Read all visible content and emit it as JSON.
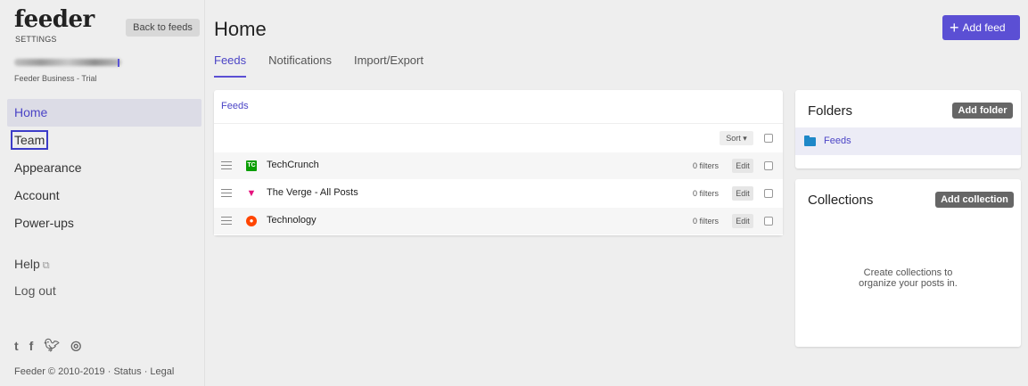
{
  "brand": {
    "logo": "feeder",
    "sub": "SETTINGS"
  },
  "sidebar": {
    "back_label": "Back to feeds",
    "plan": "Feeder Business - Trial",
    "items": [
      {
        "label": "Home"
      },
      {
        "label": "Team"
      },
      {
        "label": "Appearance"
      },
      {
        "label": "Account"
      },
      {
        "label": "Power-ups"
      }
    ],
    "help": "Help",
    "logout": "Log out",
    "footer": "Feeder © 2010-2019 · Status · Legal"
  },
  "header": {
    "title": "Home",
    "add_feed": "Add feed",
    "tabs": [
      {
        "label": "Feeds"
      },
      {
        "label": "Notifications"
      },
      {
        "label": "Import/Export"
      }
    ]
  },
  "feeds": {
    "title": "Feeds",
    "sort_label": "Sort ▾",
    "rows": [
      {
        "name": "TechCrunch",
        "filters": "0 filters",
        "edit": "Edit",
        "icon": "techcrunch-icon"
      },
      {
        "name": "The Verge - All Posts",
        "filters": "0 filters",
        "edit": "Edit",
        "icon": "verge-icon"
      },
      {
        "name": "Technology",
        "filters": "0 filters",
        "edit": "Edit",
        "icon": "reddit-icon"
      }
    ]
  },
  "folders": {
    "title": "Folders",
    "add_label": "Add folder",
    "items": [
      {
        "name": "Feeds"
      }
    ]
  },
  "collections": {
    "title": "Collections",
    "add_label": "Add collection",
    "empty_line1": "Create collections to",
    "empty_line2": "organize your posts in."
  },
  "colors": {
    "accent": "#5b4fd4",
    "folder": "#1e88c8"
  }
}
